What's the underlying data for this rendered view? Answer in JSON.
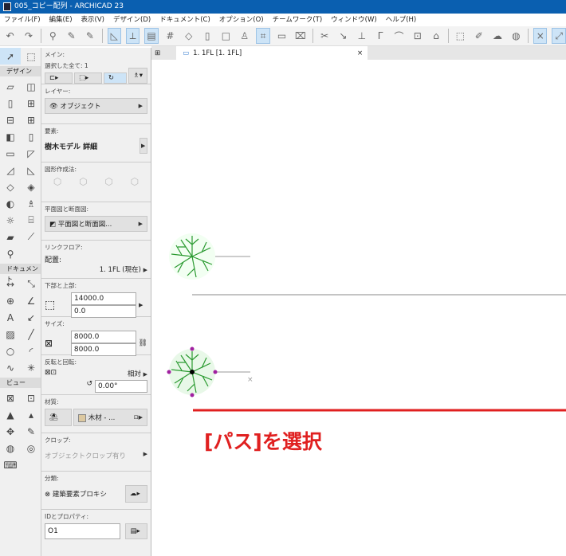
{
  "window": {
    "title": "005_コピー配列 - ARCHICAD 23"
  },
  "menu": [
    "ファイル(F)",
    "編集(E)",
    "表示(V)",
    "デザイン(D)",
    "ドキュメント(C)",
    "オプション(O)",
    "チームワーク(T)",
    "ウィンドウ(W)",
    "ヘルプ(H)"
  ],
  "toolbox": {
    "design": "デザイン",
    "document": "ドキュメント",
    "view": "ビュー"
  },
  "info": {
    "main_label": "メイン:",
    "selected": "選択した全て: 1",
    "layer_label": "レイヤー:",
    "layer": "オブジェクト",
    "element_label": "要素:",
    "element": "樹木モデル 詳細",
    "geometry_label": "図形作成法:",
    "plan_label": "平面図と断面図:",
    "plan": "平面図と断面図...",
    "floor_label": "リンクフロア:",
    "placement": "配置:",
    "floor": "1. 1FL (現在)",
    "bottom_top_label": "下部と上部:",
    "top": "14000.0",
    "bottom": "0.0",
    "size_label": "サイズ:",
    "size_x": "8000.0",
    "size_y": "8000.0",
    "rotate_label": "反転と回転:",
    "relative": "相対",
    "angle": "0.00°",
    "material_label": "材質:",
    "material": "木材 - ...",
    "crop_label": "クロップ:",
    "crop": "オブジェクトクロップ有り",
    "class_label": "分類:",
    "class": "建築要素プロキシ",
    "id_label": "IDとプロパティ:",
    "id": "O1"
  },
  "tab": {
    "label": "1. 1FL [1. 1FL]",
    "close": "×"
  },
  "annotation": "[パス]を選択",
  "colors": {
    "accent": "#e02020",
    "tree": "#22aa33"
  }
}
